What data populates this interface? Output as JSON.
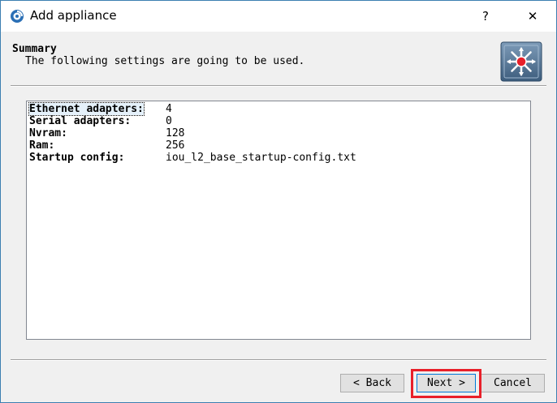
{
  "window": {
    "title": "Add appliance",
    "help_label": "?",
    "close_label": "✕"
  },
  "header": {
    "title": "Summary",
    "subtitle": "The following settings are going to be used."
  },
  "summary": {
    "rows": [
      {
        "label": "Ethernet adapters:",
        "value": "4",
        "selected": true
      },
      {
        "label": "Serial adapters:",
        "value": "0",
        "selected": false
      },
      {
        "label": "Nvram:",
        "value": "128",
        "selected": false
      },
      {
        "label": "Ram:",
        "value": "256",
        "selected": false
      },
      {
        "label": "Startup config:",
        "value": "iou_l2_base_startup-config.txt",
        "selected": false
      }
    ]
  },
  "buttons": {
    "back_label": "< Back",
    "next_label": "Next >",
    "cancel_label": "Cancel"
  },
  "colors": {
    "highlight": "#e8202a",
    "logo_bg": "#5b7a99",
    "logo_center": "#e8202a"
  },
  "icons": {
    "app": "gns3-app-icon",
    "logo": "switch-logo-icon"
  }
}
